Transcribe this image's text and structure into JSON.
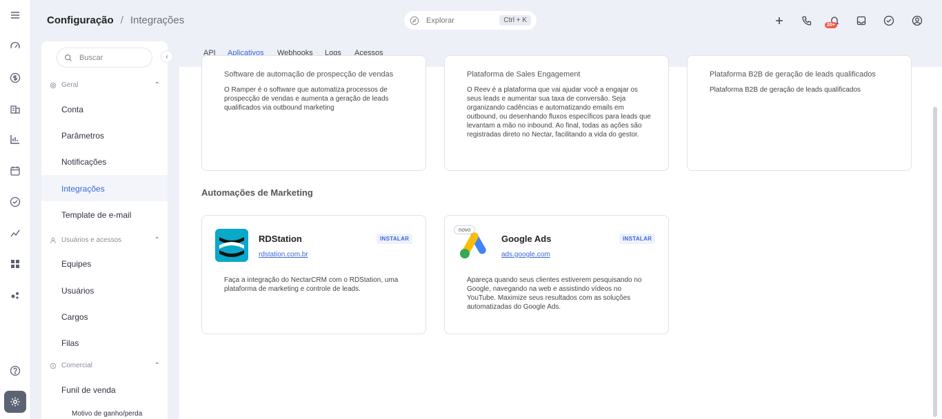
{
  "header": {
    "title": "Configuração",
    "separator": "/",
    "subtitle": "Integrações",
    "explore_label": "Explorar",
    "explore_shortcut": "Ctrl + K",
    "notification_badge": "20+"
  },
  "sidebar": {
    "search_placeholder": "Buscar",
    "sections": [
      {
        "label": "Geral",
        "items": [
          "Conta",
          "Parâmetros",
          "Notificações",
          "Integrações",
          "Template de e-mail"
        ]
      },
      {
        "label": "Usuários e acessos",
        "items": [
          "Equipes",
          "Usuários",
          "Cargos",
          "Filas"
        ]
      },
      {
        "label": "Comercial",
        "items": [
          "Funil de venda"
        ],
        "subitems": [
          "Motivo de ganho/perda"
        ]
      }
    ],
    "active_item": "Integrações"
  },
  "tabs": [
    "API",
    "Aplicativos",
    "Webhooks",
    "Logs",
    "Acessos"
  ],
  "active_tab": "Aplicativos",
  "top_cards": [
    {
      "title": "Software de automação de prospecção de vendas",
      "description": "O Ramper é o software que automatiza processos de prospecção de vendas e aumenta a geração de leads qualificados via outbound marketing"
    },
    {
      "title": "Plataforma de Sales Engagement",
      "description": "O Reev é a plataforma que vai ajudar você a engajar os seus leads e aumentar sua taxa de conversão. Seja organizando cadências e automatizando emails em outbound, ou desenhando fluxos específicos para leads que levantam a mão no inbound. Ao final, todas as ações são registradas direto no Nectar, facilitando a vida do gestor."
    },
    {
      "title": "Plataforma B2B de geração de leads qualificados",
      "description": "Plataforma B2B de geração de leads qualificados"
    }
  ],
  "marketing": {
    "section_title": "Automações de Marketing",
    "cards": [
      {
        "name": "RDStation",
        "link": "rdstation.com.br",
        "install_label": "INSTALAR",
        "description": "Faça a integração do NectarCRM com o RDStation, uma plataforma de marketing e controle de leads."
      },
      {
        "name": "Google Ads",
        "link": "ads.google.com",
        "install_label": "INSTALAR",
        "badge": "novo",
        "description": "Apareça quando seus clientes estiverem pesquisando no Google, navegando na web e assistindo vídeos no YouTube. Maximize seus resultados com as soluções automatizadas do Google Ads."
      }
    ]
  },
  "colors": {
    "accent": "#3a66d8",
    "background": "#eef0f8",
    "rdstation": "#0aa8c9",
    "badge": "#f05a4a"
  }
}
